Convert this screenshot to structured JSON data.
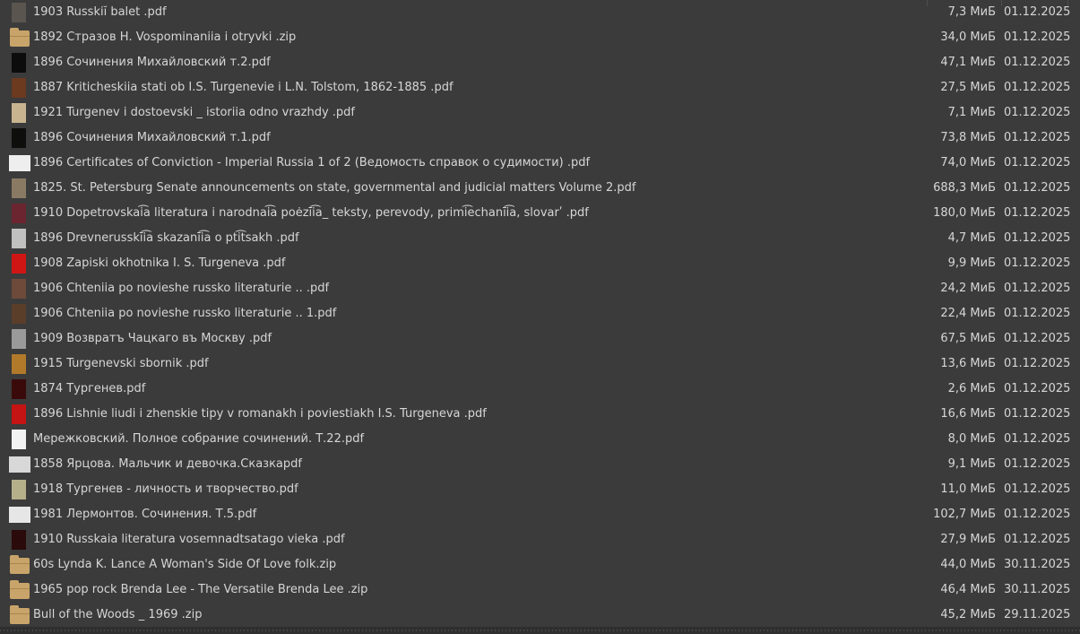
{
  "files": [
    {
      "name": "1903 Russkiĭ balet .pdf",
      "size": "7,3 МиБ",
      "date": "01.12.2025",
      "icon": "pdf-thumbnail",
      "thumb": "#5b5550",
      "kind": "doc"
    },
    {
      "name": "1892 Стразов Н.  Vospominaniia i otryvki .zip",
      "size": "34,0 МиБ",
      "date": "01.12.2025",
      "icon": "zip-archive-icon",
      "thumb": "#c8a46a",
      "kind": "zip"
    },
    {
      "name": "1896 Сочинения Михайловский т.2.pdf",
      "size": "47,1 МиБ",
      "date": "01.12.2025",
      "icon": "pdf-thumbnail",
      "thumb": "#0c0c0c",
      "kind": "doc"
    },
    {
      "name": "1887 Kriticheskiia stati ob I.S. Turgenevie i L.N. Tolstom, 1862-1885 .pdf",
      "size": "27,5 МиБ",
      "date": "01.12.2025",
      "icon": "pdf-thumbnail",
      "thumb": "#6b3a1f",
      "kind": "doc"
    },
    {
      "name": "1921  Turgenev i dostoevski _ istoriia odno vrazhdy .pdf",
      "size": "7,1 МиБ",
      "date": "01.12.2025",
      "icon": "pdf-thumbnail",
      "thumb": "#c8b590",
      "kind": "doc"
    },
    {
      "name": "1896 Сочинения Михайловский т.1.pdf",
      "size": "73,8 МиБ",
      "date": "01.12.2025",
      "icon": "pdf-thumbnail",
      "thumb": "#0e0e0c",
      "kind": "doc"
    },
    {
      "name": "1896 Certificates of Conviction - Imperial Russia 1 of 2 (Ведомость справок о судимости) .pdf",
      "size": "74,0 МиБ",
      "date": "01.12.2025",
      "icon": "pdf-thumbnail",
      "thumb": "#eeeeee",
      "kind": "wide"
    },
    {
      "name": "1825. St. Petersburg Senate announcements on state, governmental and judicial matters Volume 2.pdf",
      "size": "688,3 МиБ",
      "date": "01.12.2025",
      "icon": "pdf-thumbnail",
      "thumb": "#8a7a64",
      "kind": "doc"
    },
    {
      "name": "1910 Dopetrovskai͡a literatura i narodnai͡a poėzīi͡a_ teksty, perevody, primi͡echanīi͡a, slovarʹ .pdf",
      "size": "180,0 МиБ",
      "date": "01.12.2025",
      "icon": "pdf-thumbnail",
      "thumb": "#6a2530",
      "kind": "doc"
    },
    {
      "name": "1896 Drevnerusskīi͡a skazanīi͡a o pti͡tsakh .pdf",
      "size": "4,7 МиБ",
      "date": "01.12.2025",
      "icon": "pdf-thumbnail",
      "thumb": "#c0c0c0",
      "kind": "doc"
    },
    {
      "name": "1908 Zapiski okhotnika I. S. Turgeneva .pdf",
      "size": "9,9 МиБ",
      "date": "01.12.2025",
      "icon": "pdf-thumbnail",
      "thumb": "#d01515",
      "kind": "doc"
    },
    {
      "name": "1906 Chteniia po novieshe russko literaturie .. .pdf",
      "size": "24,2 МиБ",
      "date": "01.12.2025",
      "icon": "pdf-thumbnail",
      "thumb": "#6e4a3a",
      "kind": "doc"
    },
    {
      "name": "1906  Chteniia po novieshe russko literaturie ..  1.pdf",
      "size": "22,4 МиБ",
      "date": "01.12.2025",
      "icon": "pdf-thumbnail",
      "thumb": "#5a3e2a",
      "kind": "doc"
    },
    {
      "name": "1909 Возвратъ Чацкаго въ Москву .pdf",
      "size": "67,5 МиБ",
      "date": "01.12.2025",
      "icon": "pdf-thumbnail",
      "thumb": "#9a9a9a",
      "kind": "doc"
    },
    {
      "name": "1915 Turgenevski sbornik .pdf",
      "size": "13,6 МиБ",
      "date": "01.12.2025",
      "icon": "pdf-thumbnail",
      "thumb": "#b07a2a",
      "kind": "doc"
    },
    {
      "name": "1874 Тургенев.pdf",
      "size": "2,6 МиБ",
      "date": "01.12.2025",
      "icon": "pdf-thumbnail",
      "thumb": "#3a0a0a",
      "kind": "doc"
    },
    {
      "name": "1896  Lishnie liudi i zhenskie tipy v romanakh i poviestiakh I.S. Turgeneva .pdf",
      "size": "16,6 МиБ",
      "date": "01.12.2025",
      "icon": "pdf-thumbnail",
      "thumb": "#c41414",
      "kind": "doc"
    },
    {
      "name": "Мережковский. Полное собрание сочинений. Т.22.pdf",
      "size": "8,0 МиБ",
      "date": "01.12.2025",
      "icon": "pdf-thumbnail",
      "thumb": "#f2f2f2",
      "kind": "doc"
    },
    {
      "name": "1858 Ярцова. Мальчик и девочка.Сказкаpdf",
      "size": "9,1 МиБ",
      "date": "01.12.2025",
      "icon": "pdf-thumbnail",
      "thumb": "#d8d8d8",
      "kind": "wide"
    },
    {
      "name": "1918 Тургенев - личность и творчество.pdf",
      "size": "11,0 МиБ",
      "date": "01.12.2025",
      "icon": "pdf-thumbnail",
      "thumb": "#b5b08a",
      "kind": "doc"
    },
    {
      "name": "1981 Лермонтов. Сочинения. Т.5.pdf",
      "size": "102,7 МиБ",
      "date": "01.12.2025",
      "icon": "pdf-thumbnail",
      "thumb": "#e6e6e6",
      "kind": "wide"
    },
    {
      "name": "1910 Russkaia literatura vosemnadtsatago vieka .pdf",
      "size": "27,9 МиБ",
      "date": "01.12.2025",
      "icon": "pdf-thumbnail",
      "thumb": "#2a0a0a",
      "kind": "doc"
    },
    {
      "name": "60s Lynda K. Lance  A Woman's Side Of Love folk.zip",
      "size": "44,0 МиБ",
      "date": "30.11.2025",
      "icon": "zip-archive-icon",
      "thumb": "#c8a46a",
      "kind": "zip"
    },
    {
      "name": "1965 pop rock Brenda Lee -  The Versatile Brenda Lee .zip",
      "size": "46,4 МиБ",
      "date": "30.11.2025",
      "icon": "zip-archive-icon",
      "thumb": "#c8a46a",
      "kind": "zip"
    },
    {
      "name": "Bull of the Woods _ 1969 .zip",
      "size": "45,2 МиБ",
      "date": "29.11.2025",
      "icon": "zip-archive-icon",
      "thumb": "#c8a46a",
      "kind": "zip"
    }
  ]
}
